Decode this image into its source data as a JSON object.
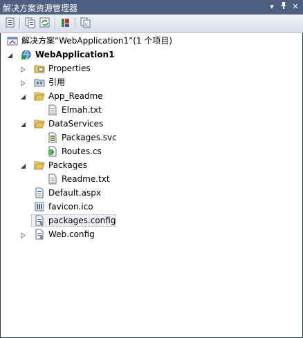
{
  "window": {
    "title": "解决方案资源管理器",
    "pin_glyph": "▾",
    "dock_glyph": "ᵜ",
    "close_glyph": "✕"
  },
  "toolbar": {
    "buttons": [
      "properties-icon",
      "show-all-files-icon",
      "refresh-icon",
      "view-class-diagram-icon",
      "view-code-icon"
    ]
  },
  "tree": {
    "solution_label": "解决方案“WebApplication1”(1 个项目)",
    "project_label": "WebApplication1",
    "items": [
      {
        "label": "Properties"
      },
      {
        "label": "引用"
      },
      {
        "label": "App_Readme"
      },
      {
        "label": "Elmah.txt"
      },
      {
        "label": "DataServices"
      },
      {
        "label": "Packages.svc"
      },
      {
        "label": "Routes.cs"
      },
      {
        "label": "Packages"
      },
      {
        "label": "Readme.txt"
      },
      {
        "label": "Default.aspx"
      },
      {
        "label": "favicon.ico"
      },
      {
        "label": "packages.config"
      },
      {
        "label": "Web.config"
      }
    ]
  },
  "colors": {
    "titlebar": "#4d6082",
    "folder": "#e8c15a",
    "selection_border": "#a3acbb"
  }
}
